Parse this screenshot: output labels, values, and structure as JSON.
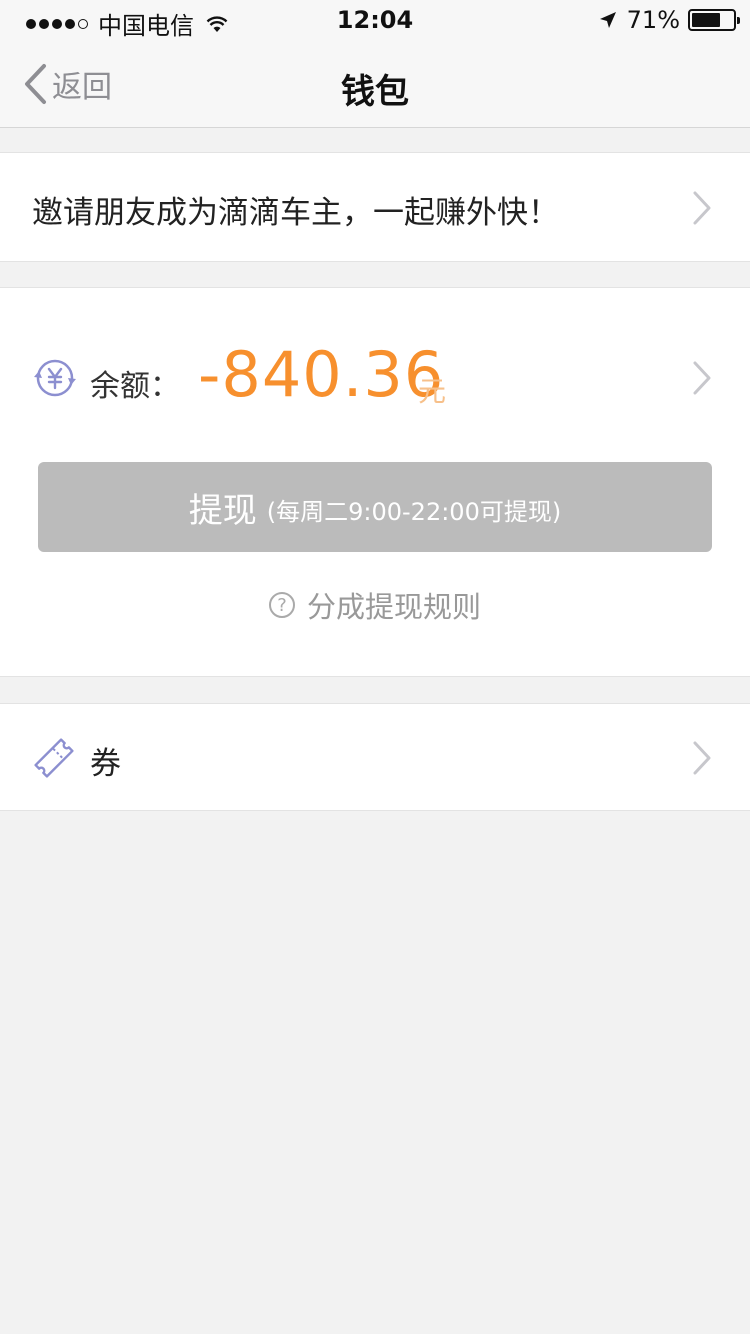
{
  "status_bar": {
    "carrier": "中国电信",
    "time": "12:04",
    "battery": "71%",
    "battery_level": 0.71
  },
  "nav": {
    "back_label": "返回",
    "title": "钱包"
  },
  "invite": {
    "text": "邀请朋友成为滴滴车主，一起赚外快！"
  },
  "balance": {
    "label": "余额：",
    "amount": "-840.36",
    "unit": "元",
    "icon": "yuan-cycle-icon"
  },
  "withdraw_button": {
    "label": "提现",
    "note": "(每周二9:00-22:00可提现)"
  },
  "rules_link": {
    "label": "分成提现规则",
    "icon": "question-icon"
  },
  "coupon": {
    "label": "券",
    "icon": "ticket-icon"
  },
  "colors": {
    "accent": "#f7902e",
    "disabled_button": "#bbbbbb",
    "background": "#f2f2f2",
    "icon_blue": "#8c8fd0"
  }
}
